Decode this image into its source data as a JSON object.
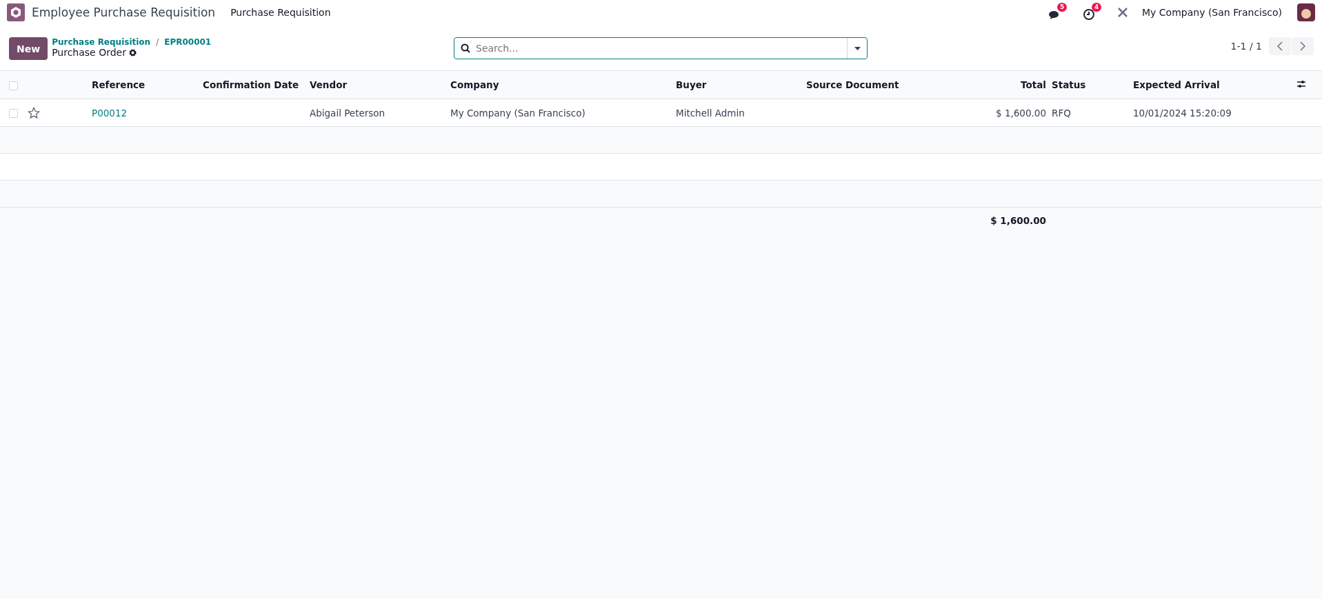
{
  "navbar": {
    "app_name": "Employee Purchase Requisition",
    "menu": [
      "Purchase Requisition"
    ],
    "messages_badge": "5",
    "activities_badge": "4",
    "company": "My Company (San Francisco)"
  },
  "control_panel": {
    "new_button": "New",
    "breadcrumbs": [
      "Purchase Requisition",
      "EPR00001"
    ],
    "breadcrumb_separator": "/",
    "view_title": "Purchase Order",
    "search": {
      "placeholder": "Search..."
    },
    "pager": "1-1 / 1"
  },
  "table": {
    "select_all_checked": false,
    "columns": [
      {
        "label": "Reference",
        "kind": "text"
      },
      {
        "label": "Confirmation Date",
        "kind": "text"
      },
      {
        "label": "Vendor",
        "kind": "text"
      },
      {
        "label": "Company",
        "kind": "text"
      },
      {
        "label": "Buyer",
        "kind": "text"
      },
      {
        "label": "Source Document",
        "kind": "text"
      },
      {
        "label": "Total",
        "kind": "monetary"
      },
      {
        "label": "Status",
        "kind": "text"
      },
      {
        "label": "Expected Arrival",
        "kind": "text"
      }
    ],
    "rows": [
      {
        "checked": false,
        "starred": false,
        "cells": [
          "P00012",
          "",
          "Abigail Peterson",
          "My Company (San Francisco)",
          "Mitchell Admin",
          "",
          "$ 1,600.00",
          "RFQ",
          "10/01/2024 15:20:09"
        ]
      }
    ],
    "footer_total": "$ 1,600.00"
  }
}
